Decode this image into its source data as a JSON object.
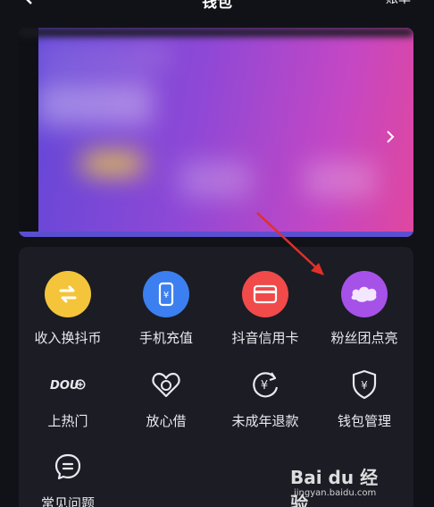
{
  "header": {
    "title": "钱包",
    "right_label": "账单"
  },
  "menu": {
    "row1": [
      {
        "label": "收入换抖币",
        "icon": "exchange-icon",
        "color": "#f4c43a"
      },
      {
        "label": "手机充值",
        "icon": "phone-recharge-icon",
        "color": "#3b7ff0"
      },
      {
        "label": "抖音信用卡",
        "icon": "credit-card-icon",
        "color": "#f04a4a"
      },
      {
        "label": "粉丝团点亮",
        "icon": "fan-club-icon",
        "color": "#a651e8"
      }
    ],
    "row2": [
      {
        "label": "上热门",
        "icon": "dou-plus-icon"
      },
      {
        "label": "放心借",
        "icon": "loan-icon"
      },
      {
        "label": "未成年退款",
        "icon": "minor-refund-icon"
      },
      {
        "label": "钱包管理",
        "icon": "wallet-shield-icon"
      }
    ],
    "row3": [
      {
        "label": "常见问题",
        "icon": "faq-icon"
      }
    ]
  },
  "watermark": {
    "brand": "Bai du 经验",
    "url": "jingyan.baidu.com"
  },
  "annotation": {
    "arrow_color": "#e0302a"
  }
}
